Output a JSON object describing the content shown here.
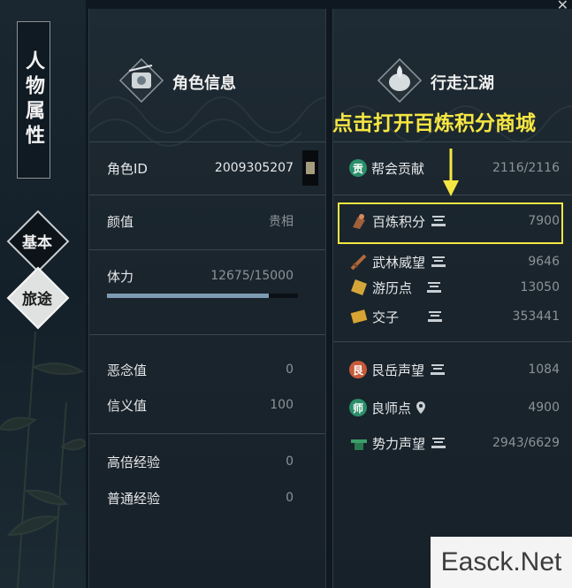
{
  "sidebar": {
    "title": "人物属性",
    "tabs": [
      {
        "label": "基本",
        "active": true
      },
      {
        "label": "旅途",
        "active": false
      }
    ]
  },
  "character_info": {
    "title": "角色信息",
    "rows": {
      "char_id": {
        "label": "角色ID",
        "value": "2009305207"
      },
      "looks": {
        "label": "颜值",
        "value": "贵相"
      },
      "stamina": {
        "label": "体力",
        "value": "12675/15000",
        "fill": 0.845
      },
      "evil": {
        "label": "恶念值",
        "value": "0"
      },
      "justice": {
        "label": "信义值",
        "value": "100"
      },
      "multi_exp": {
        "label": "高倍经验",
        "value": "0"
      },
      "normal_exp": {
        "label": "普通经验",
        "value": "0"
      }
    }
  },
  "jianghu": {
    "title": "行走江湖",
    "items": [
      {
        "name": "帮会贡献",
        "value": "2116/2116",
        "icon": "guild-icon",
        "icon_char": "贡",
        "color": "#2a8f6a"
      },
      {
        "name": "百炼积分",
        "value": "7900",
        "icon": "forge-icon",
        "color": "#a0603a"
      },
      {
        "name": "武林威望",
        "value": "9646",
        "icon": "sword-icon",
        "color": "#b06a3a"
      },
      {
        "name": "游历点",
        "value": "13050",
        "icon": "scroll-icon",
        "color": "#d5a53a"
      },
      {
        "name": "交子",
        "value": "353441",
        "icon": "banknote-icon",
        "color": "#d8a432"
      },
      {
        "name": "艮岳声望",
        "value": "1084",
        "icon": "genyue-icon",
        "icon_char": "艮",
        "color": "#c75a3a"
      },
      {
        "name": "良师点",
        "value": "4900",
        "icon": "mentor-icon",
        "icon_char": "师",
        "color": "#2a8f6a"
      },
      {
        "name": "势力声望",
        "value": "2943/6629",
        "icon": "faction-icon",
        "color": "#3aa06a"
      }
    ]
  },
  "annotation": "点击打开百炼积分商城",
  "watermark": "Easck.Net"
}
